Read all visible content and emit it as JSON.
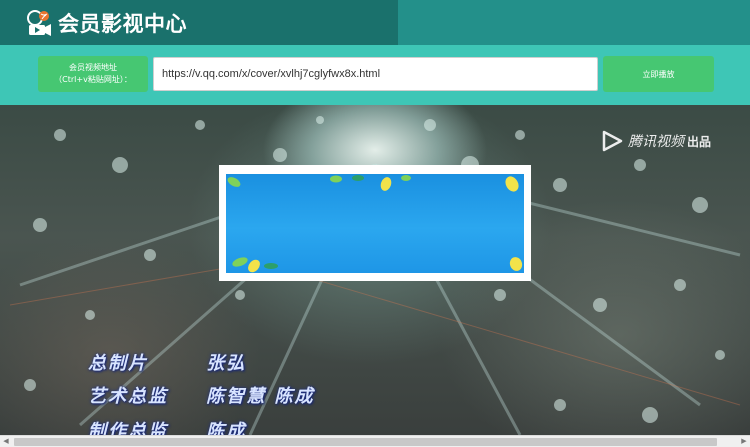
{
  "header": {
    "title": "会员影视中心"
  },
  "input_bar": {
    "label_line1": "会员视频地址",
    "label_line2": "（Ctrl+v粘贴网址）：",
    "url_value": "https://v.qq.com/x/cover/xvlhj7cglyfwx8x.html",
    "play_label": "立即播放"
  },
  "video": {
    "watermark_text": "腾讯视频",
    "watermark_sub": "出品",
    "credits": [
      {
        "role": "总制片",
        "names": "张弘"
      },
      {
        "role": "艺术总监",
        "names": "陈智慧 陈成"
      },
      {
        "role": "制作总监",
        "names": "陈成"
      }
    ]
  },
  "colors": {
    "header_dark": "#1a716c",
    "header": "#23908a",
    "bar": "#3ec6b6",
    "button": "#46c772"
  }
}
